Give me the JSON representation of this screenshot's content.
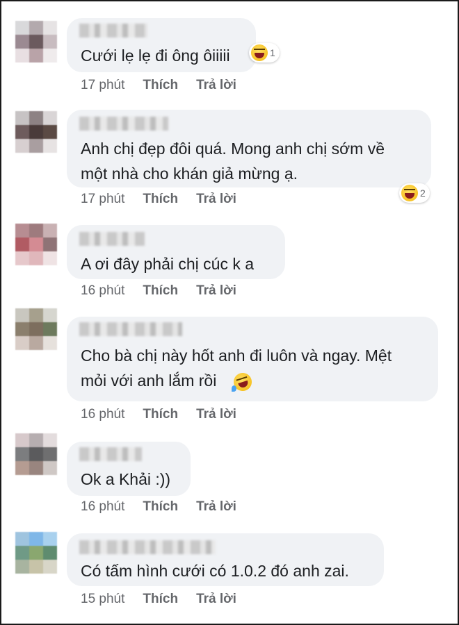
{
  "comments": [
    {
      "text": "Cưới lẹ lẹ đi ông ôiiiii",
      "time": "17 phút",
      "like_label": "Thích",
      "reply_label": "Trả lời",
      "reaction": {
        "icon": "laugh-emoji-icon",
        "count": "1"
      }
    },
    {
      "text": "Anh chị đẹp đôi quá. Mong anh chị sớm về\nmột nhà cho khán giả mừng ạ.",
      "time": "17 phút",
      "like_label": "Thích",
      "reply_label": "Trả lời",
      "reaction": {
        "icon": "laugh-emoji-icon",
        "count": "2"
      }
    },
    {
      "text": "A ơi đây phải chị cúc k a",
      "time": "16 phút",
      "like_label": "Thích",
      "reply_label": "Trả lời"
    },
    {
      "text": "Cho bà chị này hốt anh đi luôn và ngay. Mệt\nmỏi với anh lắm rồi",
      "time": "16 phút",
      "like_label": "Thích",
      "reply_label": "Trả lời",
      "inline_emoji": "rofl-emoji-icon"
    },
    {
      "text": "Ok a Khải :))",
      "time": "16 phút",
      "like_label": "Thích",
      "reply_label": "Trả lời"
    },
    {
      "text": "Có tấm hình cưới có 1.0.2 đó anh zai.",
      "time": "15 phút",
      "like_label": "Thích",
      "reply_label": "Trả lời"
    }
  ],
  "colors": {
    "bubble": "#f0f2f5",
    "text": "#1c1e21",
    "meta": "#65676b",
    "emoji": "#f7c325"
  }
}
